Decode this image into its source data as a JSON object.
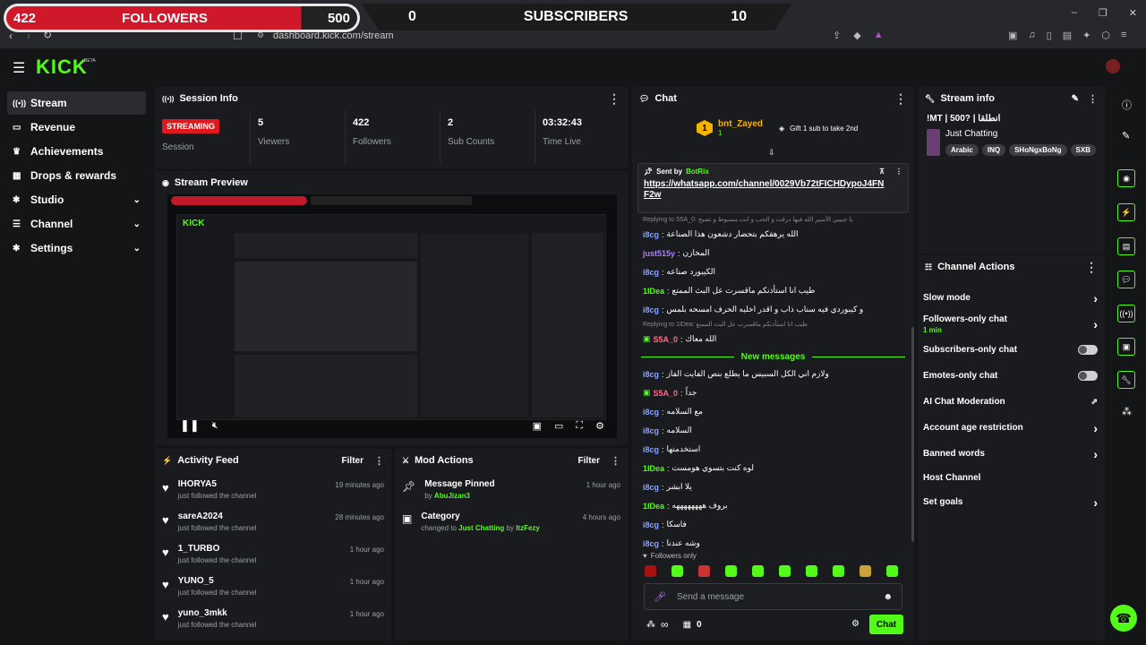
{
  "overlay": {
    "followers_count": "422",
    "followers_label": "FOLLOWERS",
    "followers_goal": "500",
    "subs_count": "0",
    "subs_label": "SUBSCRIBERS",
    "subs_goal": "10"
  },
  "browser": {
    "url": "dashboard.kick.com/stream"
  },
  "brand": {
    "logo": "KICK",
    "beta": "BETA",
    "accent": "#53fc18"
  },
  "sidebar": {
    "items": [
      {
        "label": "Stream",
        "icon": "broadcast-icon"
      },
      {
        "label": "Revenue",
        "icon": "money-icon"
      },
      {
        "label": "Achievements",
        "icon": "trophy-icon"
      },
      {
        "label": "Drops & rewards",
        "icon": "gift-icon"
      },
      {
        "label": "Studio",
        "icon": "gear-icon"
      },
      {
        "label": "Channel",
        "icon": "list-icon"
      },
      {
        "label": "Settings",
        "icon": "gear-icon"
      }
    ]
  },
  "session": {
    "title": "Session Info",
    "status_badge": "STREAMING",
    "status_label": "Session",
    "stats": [
      {
        "value": "5",
        "label": "Viewers"
      },
      {
        "value": "422",
        "label": "Followers"
      },
      {
        "value": "2",
        "label": "Sub Counts"
      },
      {
        "value": "03:32:43",
        "label": "Time Live"
      }
    ]
  },
  "preview": {
    "title": "Stream Preview"
  },
  "activity": {
    "title": "Activity Feed",
    "filter": "Filter",
    "items": [
      {
        "name": "IHORYA5",
        "action": "just followed the channel",
        "time": "19 minutes ago"
      },
      {
        "name": "sareA2024",
        "action": "just followed the channel",
        "time": "28 minutes ago"
      },
      {
        "name": "1_TURBO",
        "action": "just followed the channel",
        "time": "1 hour ago"
      },
      {
        "name": "YUNO_5",
        "action": "just followed the channel",
        "time": "1 hour ago"
      },
      {
        "name": "yuno_3mkk",
        "action": "just followed the channel",
        "time": "1 hour ago"
      }
    ]
  },
  "mod": {
    "title": "Mod Actions",
    "filter": "Filter",
    "items": [
      {
        "title": "Message Pinned",
        "pre": "by",
        "user": "AbuJizan3",
        "mid": "",
        "user2": "",
        "time": "1 hour ago"
      },
      {
        "title": "Category",
        "pre": "changed to",
        "user": "Just Chatting",
        "mid": "by",
        "user2": "ItzFezy",
        "time": "4 hours ago"
      }
    ]
  },
  "chat": {
    "title": "Chat",
    "top_user": "bnt_Zayed",
    "top_count": "1",
    "gift_label": "Gift 1 sub to take 2nd",
    "pinned_sent_by": "Sent by",
    "pinned_user": "BotRix",
    "pinned_link": "https://whatsapp.com/channel/0029Vb72tFICHDypoJ4FNF2w",
    "messages": [
      {
        "user": "",
        "text": "Replying to S5A_0: يا حبيبي الأسير الله فيها درقت و الحب و انت مسبوط و تصيح",
        "reply": true
      },
      {
        "user": "i8cg",
        "text": "الله يرهقكم بتحضار دشعون هذا الصناعة"
      },
      {
        "user": "just515y",
        "text": "المخازن"
      },
      {
        "user": "i8cg",
        "text": "الكيبورد صناعه"
      },
      {
        "user": "1IDea",
        "text": "طيب انا استأذنكم ماقسرت عل البث الممتع"
      },
      {
        "user": "i8cg",
        "text": "و كيبوردي فيه سناب ذاب و اقدر اخليه الحرف امسحه بلمس"
      },
      {
        "user": "",
        "text": "Replying to 1IDea: طيب انا استأذنكم ماقسرت عل البث الممتع",
        "reply": true
      },
      {
        "user": "S5A_0",
        "text": "الله معاك"
      }
    ],
    "new_messages": "New messages",
    "messages2": [
      {
        "user": "i8cg",
        "text": "ولازم اني الكل السبيس ما يطلع بنص الفايت الفاز"
      },
      {
        "user": "S5A_0",
        "text": "جداً"
      },
      {
        "user": "i8cg",
        "text": "مع السلامه"
      },
      {
        "user": "i8cg",
        "text": "السلامه"
      },
      {
        "user": "i8cg",
        "text": "استخدمتها"
      },
      {
        "user": "1IDea",
        "text": "لوه كنت بتسوي هومست"
      },
      {
        "user": "i8cg",
        "text": "يلا ابشر"
      },
      {
        "user": "1IDea",
        "text": "بروف ههههههههه"
      },
      {
        "user": "i8cg",
        "text": "فاسكا"
      },
      {
        "user": "i8cg",
        "text": "وشه عندنا"
      }
    ],
    "followers_only": "Followers only",
    "placeholder": "Send a message",
    "points": "0",
    "send_label": "Chat"
  },
  "stream_info": {
    "title": "Stream info",
    "stream_title": "!MT | 500? | انطلقا",
    "category": "Just Chatting",
    "tags": [
      "Arabic",
      "INQ",
      "SHoNgxBoNg",
      "SXB"
    ]
  },
  "channel_actions": {
    "title": "Channel Actions",
    "items": [
      {
        "label": "Slow mode",
        "kind": "chevron",
        "sub": ""
      },
      {
        "label": "Followers-only chat",
        "kind": "chevron",
        "sub": "1 min"
      },
      {
        "label": "Subscribers-only chat",
        "kind": "toggle",
        "sub": ""
      },
      {
        "label": "Emotes-only chat",
        "kind": "toggle",
        "sub": ""
      },
      {
        "label": "AI Chat Moderation",
        "kind": "external",
        "sub": ""
      },
      {
        "label": "Account age restriction",
        "kind": "chevron",
        "sub": ""
      },
      {
        "label": "Banned words",
        "kind": "chevron",
        "sub": ""
      },
      {
        "label": "Host Channel",
        "kind": "none",
        "sub": ""
      },
      {
        "label": "Set goals",
        "kind": "chevron",
        "sub": ""
      }
    ]
  }
}
